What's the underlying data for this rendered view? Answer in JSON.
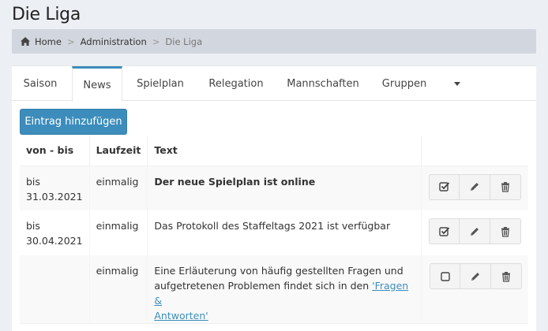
{
  "page": {
    "title": "Die Liga"
  },
  "breadcrumb": {
    "home": "Home",
    "admin": "Administration",
    "current": "Die Liga",
    "separator": ">"
  },
  "tabs": [
    {
      "label": "Saison"
    },
    {
      "label": "News"
    },
    {
      "label": "Spielplan"
    },
    {
      "label": "Relegation"
    },
    {
      "label": "Mannschaften"
    },
    {
      "label": "Gruppen"
    }
  ],
  "toolbar": {
    "add_label": "Eintrag hinzufügen"
  },
  "table": {
    "headers": {
      "von_bis": "von - bis",
      "laufzeit": "Laufzeit",
      "text": "Text"
    },
    "rows": [
      {
        "von_bis_1": "bis",
        "von_bis_2": "31.03.2021",
        "laufzeit": "einmalig",
        "text": "Der neue Spielplan ist online",
        "active": true
      },
      {
        "von_bis_1": "bis",
        "von_bis_2": "30.04.2021",
        "laufzeit": "einmalig",
        "text": "Das Protokoll des Staffeltags 2021 ist verfügbar",
        "active": true
      },
      {
        "von_bis_1": "",
        "von_bis_2": "",
        "laufzeit": "einmalig",
        "text_1": "Eine Erläuterung von häufig gestellten Fragen und",
        "text_2": "aufgetretenen Problemen findet sich in den ",
        "link_1": "'Fragen &",
        "link_2": "Antworten'",
        "active": false
      }
    ]
  }
}
